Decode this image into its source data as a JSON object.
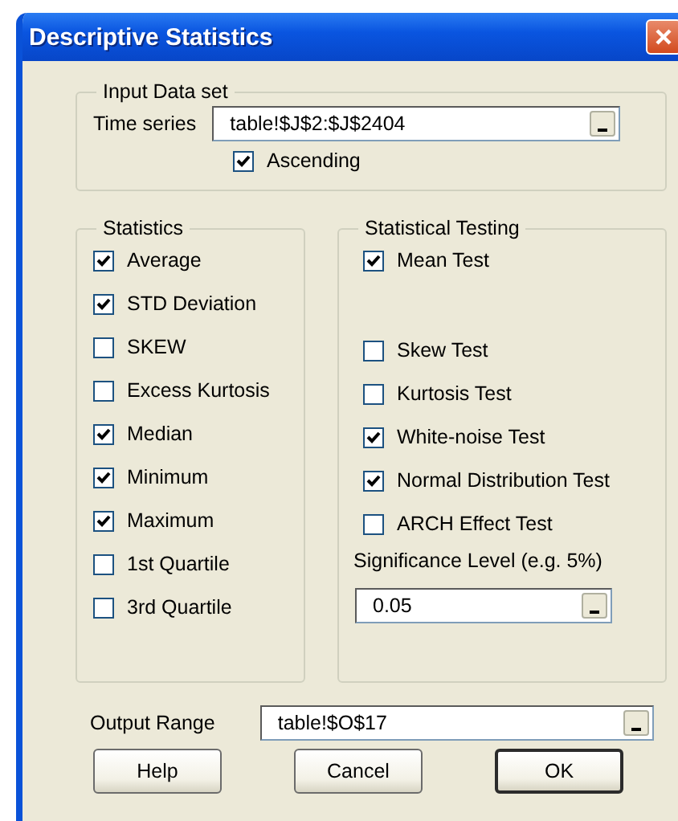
{
  "window": {
    "title": "Descriptive Statistics"
  },
  "input_data_set": {
    "legend": "Input Data set",
    "time_series": {
      "label": "Time series",
      "value": "table!$J$2:$J$2404"
    },
    "ascending": {
      "label": "Ascending",
      "checked": true
    }
  },
  "statistics": {
    "legend": "Statistics",
    "items": [
      {
        "label": "Average",
        "checked": true
      },
      {
        "label": "STD Deviation",
        "checked": true
      },
      {
        "label": "SKEW",
        "checked": false
      },
      {
        "label": "Excess Kurtosis",
        "checked": false
      },
      {
        "label": "Median",
        "checked": true
      },
      {
        "label": "Minimum",
        "checked": true
      },
      {
        "label": "Maximum",
        "checked": true
      },
      {
        "label": "1st Quartile",
        "checked": false
      },
      {
        "label": "3rd Quartile",
        "checked": false
      }
    ]
  },
  "statistical_testing": {
    "legend": "Statistical Testing",
    "items": [
      {
        "label": "Mean Test",
        "checked": true
      },
      {
        "label": "Skew Test",
        "checked": false
      },
      {
        "label": "Kurtosis Test",
        "checked": false
      },
      {
        "label": "White-noise Test",
        "checked": true
      },
      {
        "label": "Normal Distribution Test",
        "checked": true
      },
      {
        "label": "ARCH Effect Test",
        "checked": false
      }
    ],
    "significance": {
      "label": "Significance Level (e.g. 5%)",
      "value": "0.05"
    }
  },
  "output_range": {
    "label": "Output Range",
    "value": "table!$O$17"
  },
  "buttons": [
    {
      "label": "Help",
      "default": false
    },
    {
      "label": "Cancel",
      "default": false
    },
    {
      "label": "OK",
      "default": true
    }
  ]
}
